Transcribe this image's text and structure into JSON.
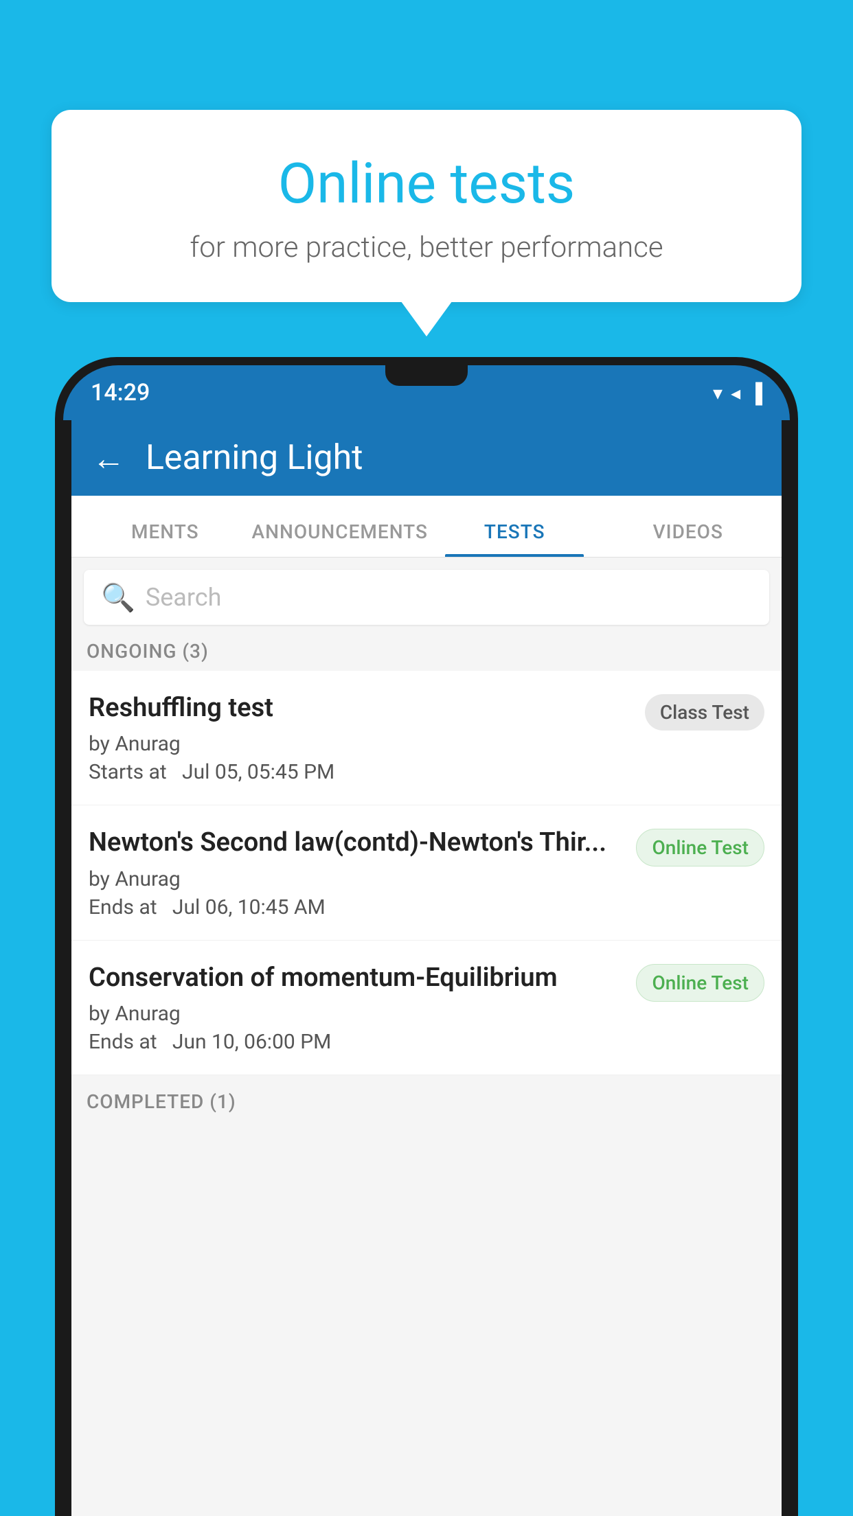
{
  "background": {
    "color": "#1ab8e8"
  },
  "speech_bubble": {
    "title": "Online tests",
    "subtitle": "for more practice, better performance"
  },
  "phone": {
    "status_bar": {
      "time": "14:29",
      "icons": "▼◀▐"
    },
    "app_bar": {
      "back_label": "←",
      "title": "Learning Light"
    },
    "tabs": [
      {
        "label": "MENTS",
        "active": false
      },
      {
        "label": "ANNOUNCEMENTS",
        "active": false
      },
      {
        "label": "TESTS",
        "active": true
      },
      {
        "label": "VIDEOS",
        "active": false
      }
    ],
    "search": {
      "placeholder": "Search"
    },
    "ongoing_section": {
      "label": "ONGOING (3)"
    },
    "tests": [
      {
        "name": "Reshuffling test",
        "author": "by Anurag",
        "time_label": "Starts at",
        "time": "Jul 05, 05:45 PM",
        "badge": "Class Test",
        "badge_type": "class"
      },
      {
        "name": "Newton's Second law(contd)-Newton's Thir...",
        "author": "by Anurag",
        "time_label": "Ends at",
        "time": "Jul 06, 10:45 AM",
        "badge": "Online Test",
        "badge_type": "online"
      },
      {
        "name": "Conservation of momentum-Equilibrium",
        "author": "by Anurag",
        "time_label": "Ends at",
        "time": "Jun 10, 06:00 PM",
        "badge": "Online Test",
        "badge_type": "online"
      }
    ],
    "completed_section": {
      "label": "COMPLETED (1)"
    }
  }
}
